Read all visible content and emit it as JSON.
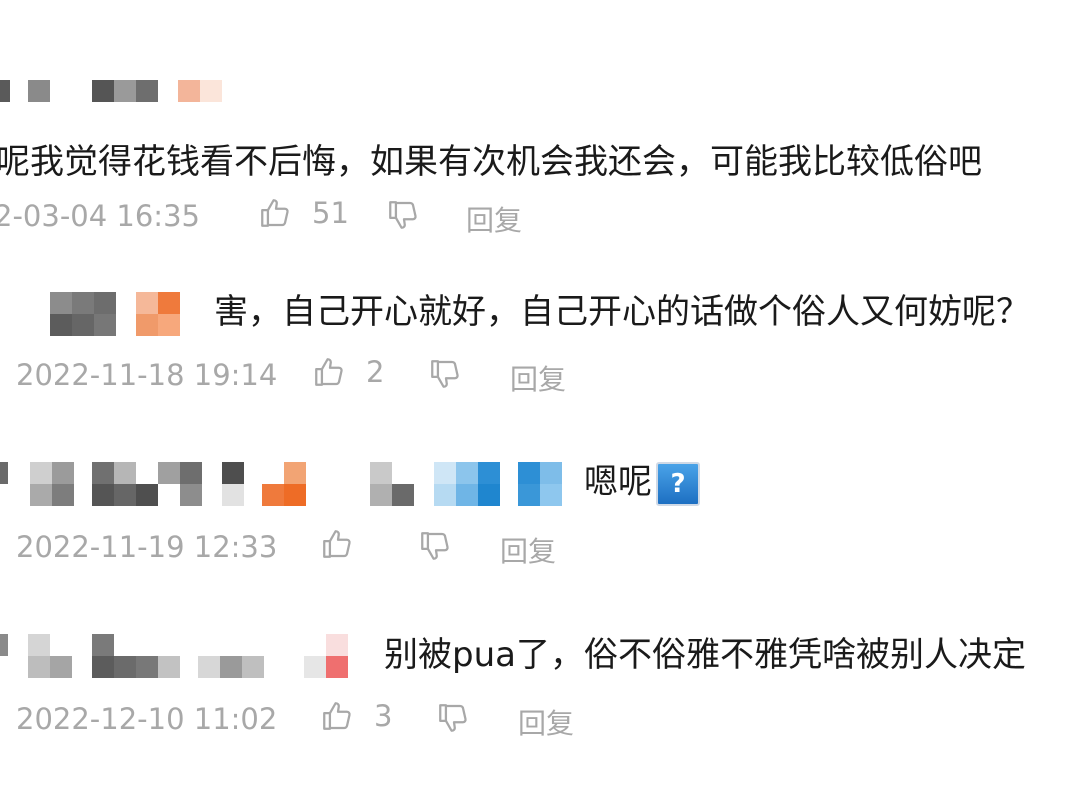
{
  "comments": [
    {
      "text": "呢我觉得花钱看不后悔，如果有次机会我还会，可能我比较低俗吧",
      "time": "2-03-04 16:35",
      "likes": "51",
      "reply_label": "回复"
    },
    {
      "text": "害，自己开心就好，自己开心的话做个俗人又何妨呢？",
      "time": "2022-11-18 19:14",
      "likes": "2",
      "reply_label": "回复"
    },
    {
      "text": "嗯呢",
      "emoji": "?",
      "time": "2022-11-19 12:33",
      "likes": "",
      "reply_label": "回复"
    },
    {
      "text": "别被pua了，俗不俗雅不雅凭啥被别人决定",
      "time": "2022-12-10 11:02",
      "likes": "3",
      "reply_label": "回复"
    }
  ],
  "icons": {
    "like": "thumbs-up-icon",
    "dislike": "thumbs-down-icon"
  },
  "colors": {
    "text": "#1a1a1a",
    "meta": "#a8a8a8",
    "pixel_gray": "#6b6b6b",
    "pixel_orange": "#ef7a3c",
    "pixel_blue": "#2d8fd5"
  }
}
